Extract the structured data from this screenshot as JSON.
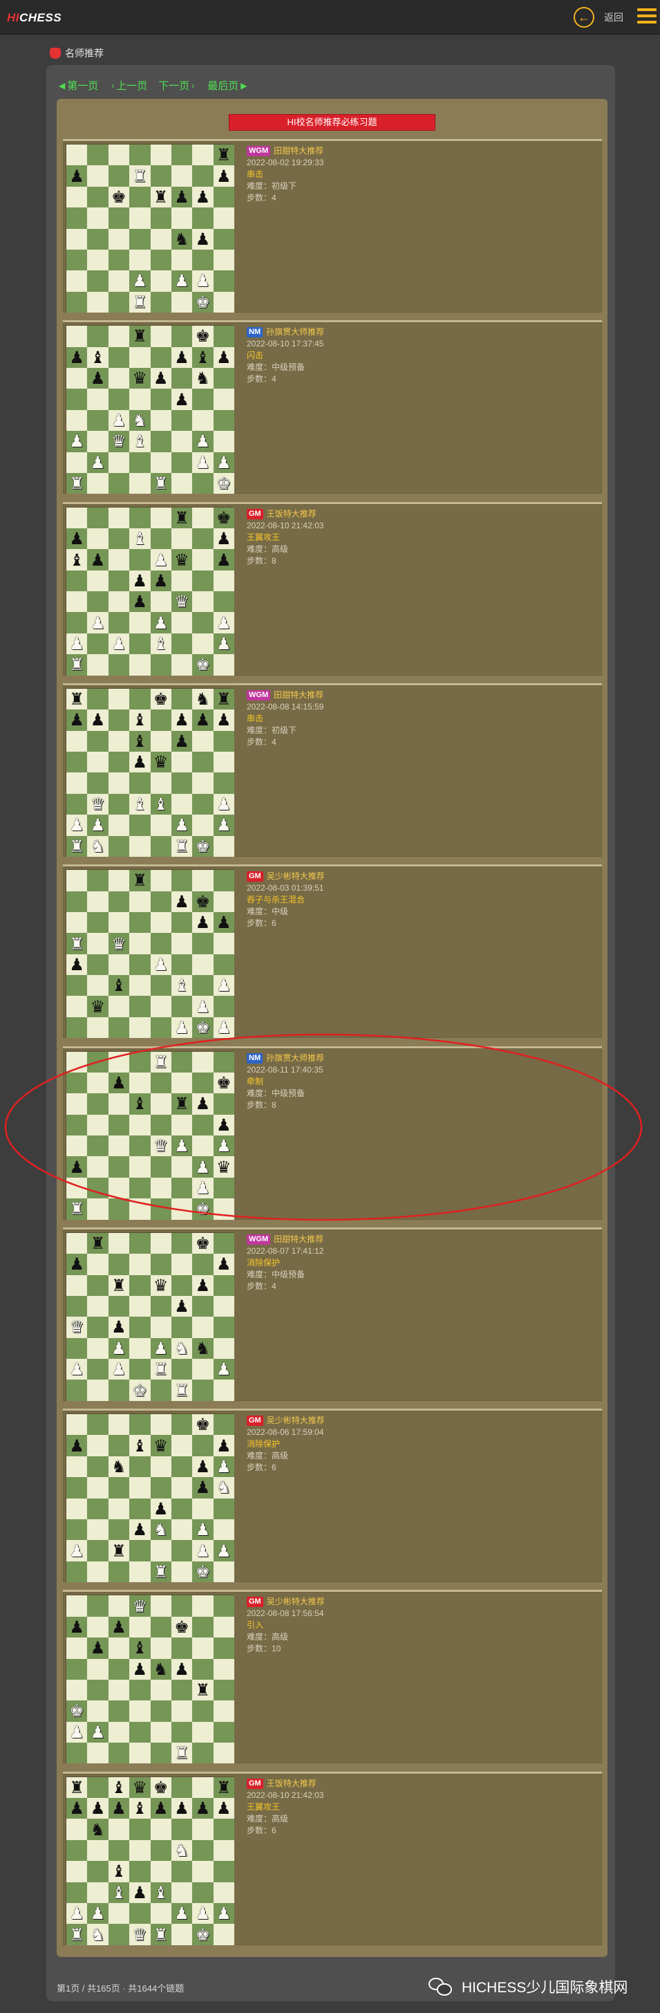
{
  "header": {
    "logo_hi": "HI",
    "logo_chess": "CHESS",
    "back_label": "返回",
    "back_icon": "arrow-left-icon",
    "menu_icon": "hamburger-menu-icon"
  },
  "breadcrumb": "名师推荐",
  "pager": {
    "first": "第一页",
    "prev": "上一页",
    "next": "下一页",
    "last": "最后页"
  },
  "banner": "HI校名师推荐必练习题",
  "puzzles": [
    {
      "title": "WGM",
      "author": "田甜特大推荐",
      "date": "2022-08-02 19:29:33",
      "theme": "串击",
      "difficulty": "难度：初级下",
      "steps": "步数：4",
      "board": [
        "-------r",
        "p--R---p",
        "--k-rpp-",
        "--------",
        "-----np-",
        "--------",
        "---P-PP-",
        "---R--K-"
      ]
    },
    {
      "title": "NM",
      "author": "孙旗贯大师推荐",
      "date": "2022-08-10 17:37:45",
      "theme": "闪击",
      "difficulty": "难度：中级预备",
      "steps": "步数：4",
      "board": [
        "---r--k-",
        "pb---pbp",
        "-p-qp-n-",
        "-----p--",
        "--PN----",
        "P-QB--P-",
        "-P----PP",
        "R---R--K"
      ]
    },
    {
      "title": "GM",
      "author": "王饭特大推荐",
      "date": "2022-08-10 21:42:03",
      "theme": "王翼攻王",
      "difficulty": "难度：高级",
      "steps": "步数：8",
      "board": [
        "-----r-k",
        "p--B---p",
        "bp--Pq-p",
        "---pp---",
        "---p-Q--",
        "-P--P--P",
        "P-P-B--P",
        "R-----K-"
      ]
    },
    {
      "title": "WGM",
      "author": "田甜特大推荐",
      "date": "2022-08-08 14:15:59",
      "theme": "串击",
      "difficulty": "难度：初级下",
      "steps": "步数：4",
      "board": [
        "r---k-nr",
        "pp-b-ppp",
        "---b-p--",
        "---pq---",
        "--------",
        "-Q-BB--P",
        "PP---P-P",
        "RN---RK-"
      ]
    },
    {
      "title": "GM",
      "author": "吴少彬特大推荐",
      "date": "2022-08-03 01:39:51",
      "theme": "吞子与杀王混合",
      "difficulty": "难度：中级",
      "steps": "步数：6",
      "board": [
        "---r----",
        "-----pk-",
        "------pp",
        "R-Q-----",
        "p---P---",
        "--b--B-P",
        "-q----P-",
        "-----PKP"
      ]
    },
    {
      "title": "NM",
      "author": "孙旗贯大师推荐",
      "date": "2022-08-11 17:40:35",
      "theme": "牵制",
      "difficulty": "难度：中级预备",
      "steps": "步数：8",
      "board": [
        "----R---",
        "--p----k",
        "---b-rp-",
        "-------p",
        "----QP-P",
        "p-----Pq",
        "------P-",
        "R-----K-"
      ]
    },
    {
      "title": "WGM",
      "author": "田甜特大推荐",
      "date": "2022-08-07 17:41:12",
      "theme": "消除保护",
      "difficulty": "难度：中级预备",
      "steps": "步数：4",
      "board": [
        "-r----k-",
        "p------p",
        "--r-q-p-",
        "-----p--",
        "Q-p-----",
        "--P-PNn-",
        "P-P-R--P",
        "---K-R--"
      ]
    },
    {
      "title": "GM",
      "author": "吴少彬特大推荐",
      "date": "2022-08-06 17:59:04",
      "theme": "消除保护",
      "difficulty": "难度：高级",
      "steps": "步数：6",
      "board": [
        "------k-",
        "p--bq--p",
        "--n---pP",
        "------pN",
        "----p---",
        "---pN-P-",
        "P-r---PP",
        "----R-K-"
      ]
    },
    {
      "title": "GM",
      "author": "吴少彬特大推荐",
      "date": "2022-08-08 17:56:54",
      "theme": "引入",
      "difficulty": "难度：高级",
      "steps": "步数：10",
      "board": [
        "---Q----",
        "p-p--k--",
        "-p-b----",
        "---pnp--",
        "------r-",
        "K-------",
        "PP------",
        "-----R--"
      ]
    },
    {
      "title": "GM",
      "author": "王饭特大推荐",
      "date": "2022-08-10 21:42:03",
      "theme": "王翼攻王",
      "difficulty": "难度：高级",
      "steps": "步数：6",
      "board": [
        "r-bqk--r",
        "pppbpppp",
        "-n------",
        "-----N--",
        "--b-----",
        "--BpB---",
        "PP---PPP",
        "RN-QR-K-"
      ]
    }
  ],
  "footer": "第1页 / 共165页 · 共1644个链题",
  "watermark": "HICHESS少儿国际象棋网",
  "colors": {
    "light_square": "#eeeed2",
    "dark_square": "#769656",
    "panel": "#8b7c56",
    "card": "#776a46",
    "accent_gold": "#f2b21b",
    "link_green": "#4fe04f",
    "banner_red": "#d9202a",
    "annotation_red": "#e02020"
  }
}
